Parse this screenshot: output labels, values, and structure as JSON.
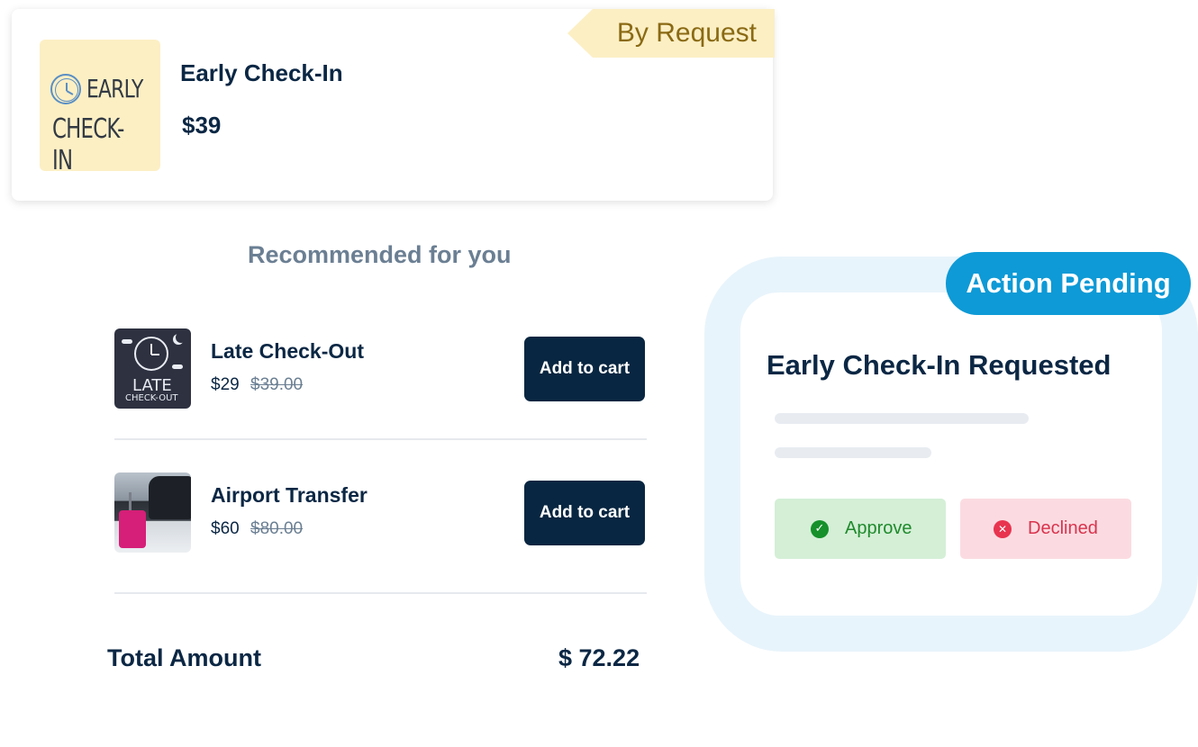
{
  "offer": {
    "badge": "By Request",
    "image_line1": "EARLY",
    "image_line2": "CHECK-IN",
    "title": "Early Check-In",
    "price": "$39",
    "colors": {
      "badge_bg": "#fcefc4",
      "badge_text": "#8a6a14"
    }
  },
  "recommended": {
    "heading": "Recommended for you",
    "items": [
      {
        "name": "Late Check-Out",
        "price": "$29",
        "original_price": "$39.00",
        "image_line1": "LATE",
        "image_line2": "CHECK-OUT",
        "button_label": "Add to cart"
      },
      {
        "name": "Airport Transfer",
        "price": "$60",
        "original_price": "$80.00",
        "button_label": "Add to cart"
      }
    ]
  },
  "total": {
    "label": "Total Amount",
    "value": "$ 72.22"
  },
  "pending": {
    "badge": "Action Pending",
    "title": "Early Check-In Requested",
    "approve_label": "Approve",
    "approve_icon": "check-circle-icon",
    "decline_label": "Declined",
    "decline_icon": "x-circle-icon",
    "colors": {
      "badge_bg": "#0e9ad6",
      "approve_bg": "#d4efd6",
      "decline_bg": "#fbdbe1",
      "button_bg": "#082641"
    }
  }
}
